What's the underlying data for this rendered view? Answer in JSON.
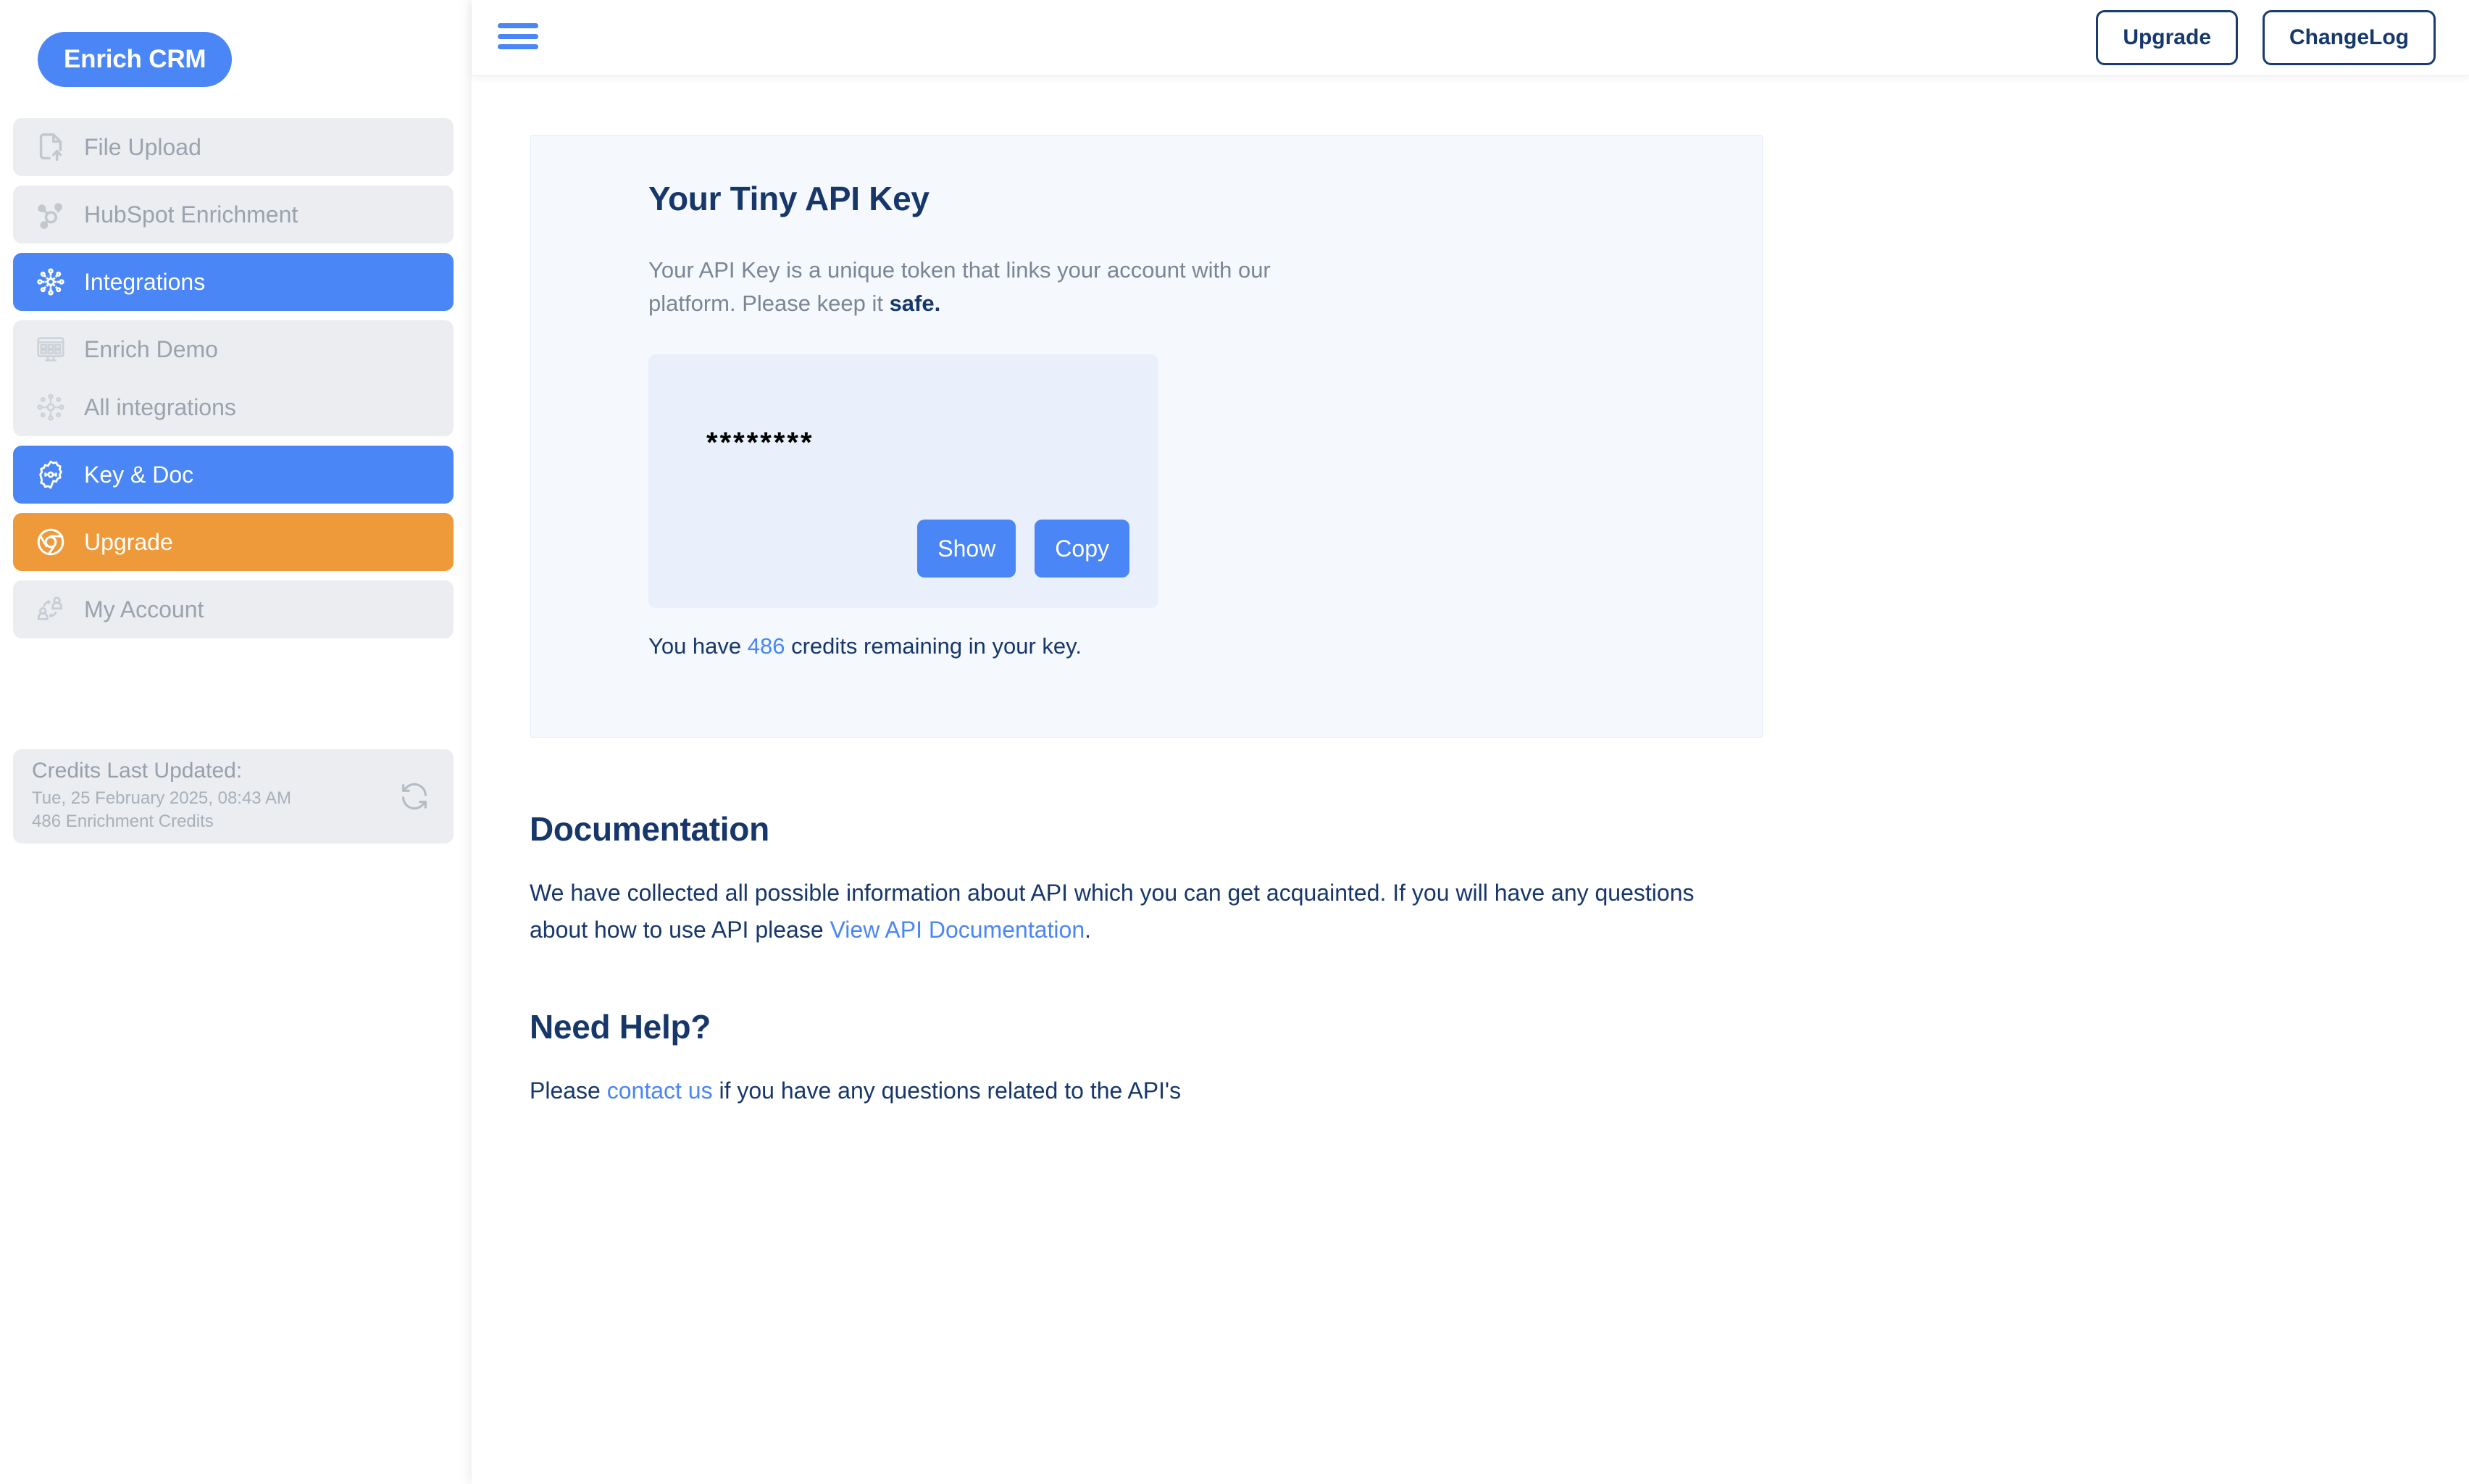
{
  "app": {
    "logo": "Enrich CRM"
  },
  "sidebar": {
    "items": [
      {
        "label": "File Upload",
        "icon": "file-upload-icon",
        "state": "default"
      },
      {
        "label": "HubSpot Enrichment",
        "icon": "hubspot-icon",
        "state": "default"
      },
      {
        "label": "Integrations",
        "icon": "integrations-icon",
        "state": "active"
      },
      {
        "label": "Enrich Demo",
        "icon": "demo-monitor-icon",
        "state": "sub"
      },
      {
        "label": "All integrations",
        "icon": "all-integrations-icon",
        "state": "sub"
      },
      {
        "label": "Key & Doc",
        "icon": "gear-key-icon",
        "state": "active"
      },
      {
        "label": "Upgrade",
        "icon": "upgrade-shield-icon",
        "state": "upgrade"
      },
      {
        "label": "My Account",
        "icon": "account-users-icon",
        "state": "default"
      }
    ],
    "credits": {
      "title": "Credits Last Updated:",
      "timestamp": "Tue, 25 February 2025, 08:43 AM",
      "amount": "486 Enrichment Credits",
      "refresh_icon": "refresh-icon"
    }
  },
  "topbar": {
    "menu_icon": "hamburger-menu-icon",
    "upgrade_label": "Upgrade",
    "changelog_label": "ChangeLog"
  },
  "api_card": {
    "title": "Your Tiny API Key",
    "description_part1": "Your API Key is a unique token that links your account with our platform. Please keep it ",
    "description_bold": "safe.",
    "key_masked": "********",
    "show_label": "Show",
    "copy_label": "Copy",
    "credits_prefix": "You have ",
    "credits_count": "486",
    "credits_suffix": " credits remaining in your key."
  },
  "documentation": {
    "heading": "Documentation",
    "body_part1": "We have collected all possible information about API which you can get acquainted. If you will have any questions about how to use API please ",
    "link_label": "View API Documentation",
    "body_part2": "."
  },
  "help": {
    "heading": "Need Help?",
    "body_part1": "Please ",
    "link_label": "contact us",
    "body_part2": " if you have any questions related to the API's"
  },
  "colors": {
    "accent_blue": "#4a86f5",
    "orange": "#ef9a3a",
    "navy": "#17376b",
    "card_bg": "#f5f9fe",
    "key_box_bg": "#e9f0fc",
    "nav_idle_bg": "#ebedf0"
  }
}
